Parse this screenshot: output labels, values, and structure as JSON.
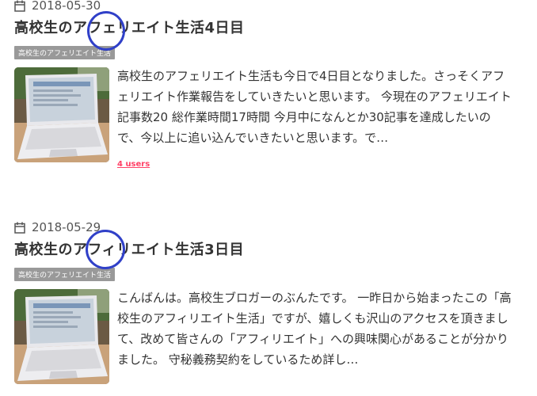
{
  "posts": [
    {
      "date": "2018-05-30",
      "title": "高校生のアフェリエイト生活4日目",
      "tag": "高校生のアフェリエイト生活",
      "excerpt": "高校生のアフェリエイト生活も今日で4日目となりました。さっそくアフェリエイト作業報告をしていきたいと思います。 今現在のアフェリエイト記事数20 総作業時間17時間 今月中になんとか30記事を達成したいので、今以上に追い込んでいきたいと思います。で…",
      "users": "4 users"
    },
    {
      "date": "2018-05-29",
      "title": "高校生のアフィリエイト生活3日目",
      "tag": "高校生のアフェリエイト生活",
      "excerpt": "こんばんは。高校生ブロガーのぶんたです。 一昨日から始まったこの「高校生のアフィリエイト生活」ですが、嬉しくも沢山のアクセスを頂きまして、改めて皆さんの「アフィリエイト」への興味関心があることが分かりました。 守秘義務契約をしているため詳し…"
    }
  ],
  "icons": {
    "date": "calendar-icon",
    "thumbnail": "laptop-photo"
  },
  "colors": {
    "tag_bg": "#999999",
    "users_badge": "#ff4166",
    "annotation": "#3040c8"
  }
}
